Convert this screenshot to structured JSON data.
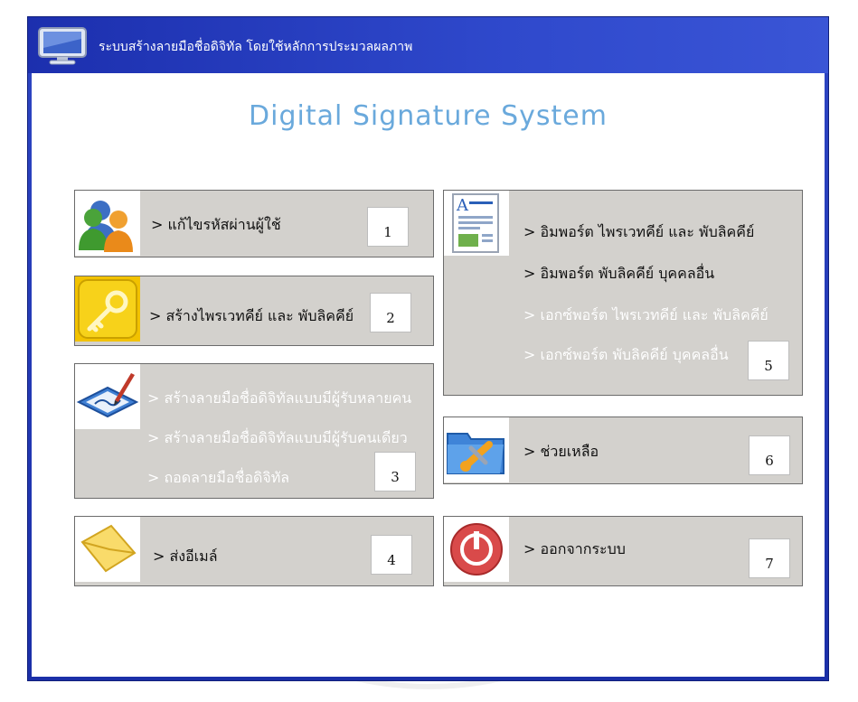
{
  "window": {
    "title": "ระบบสร้างลายมือชื่อดิจิทัล โดยใช้หลักการประมวลผลภาพ",
    "app_heading": "Digital Signature System"
  },
  "panels": {
    "change_password": {
      "icon": "users-icon",
      "items": [
        "> แก้ไขรหัสผ่านผู้ใช้"
      ],
      "number": "1"
    },
    "create_keys": {
      "icon": "key-icon",
      "items": [
        "> สร้างไพรเวทคีย์ และ พับลิคคีย์"
      ],
      "number": "2"
    },
    "signature": {
      "icon": "signature-pen-icon",
      "items": [
        "> สร้างลายมือชื่อดิจิทัลแบบมีผู้รับหลายคน",
        "> สร้างลายมือชื่อดิจิทัลแบบมีผู้รับคนเดียว",
        "> ถอดลายมือชื่อดิจิทัล"
      ],
      "number": "3"
    },
    "send_email": {
      "icon": "envelope-icon",
      "items": [
        "> ส่งอีเมล์"
      ],
      "number": "4"
    },
    "import_export": {
      "icon": "document-icon",
      "items": [
        "> อิมพอร์ต ไพรเวทคีย์ และ พับลิคคีย์",
        "> อิมพอร์ต พับลิคคีย์ บุคคลอื่น",
        "> เอกซ์พอร์ต ไพรเวทคีย์ และ พับลิคคีย์",
        "> เอกซ์พอร์ต พับลิคคีย์ บุคคลอื่น"
      ],
      "number": "5"
    },
    "help": {
      "icon": "help-folder-tools-icon",
      "items": [
        "> ช่วยเหลือ"
      ],
      "number": "6"
    },
    "logout": {
      "icon": "power-icon",
      "items": [
        "> ออกจากระบบ"
      ],
      "number": "7"
    }
  },
  "colors": {
    "frame": "#1b2fa8",
    "panel": "#d3d1cd",
    "heading": "#6aa9dc",
    "disabled_text": "#ffffff"
  }
}
